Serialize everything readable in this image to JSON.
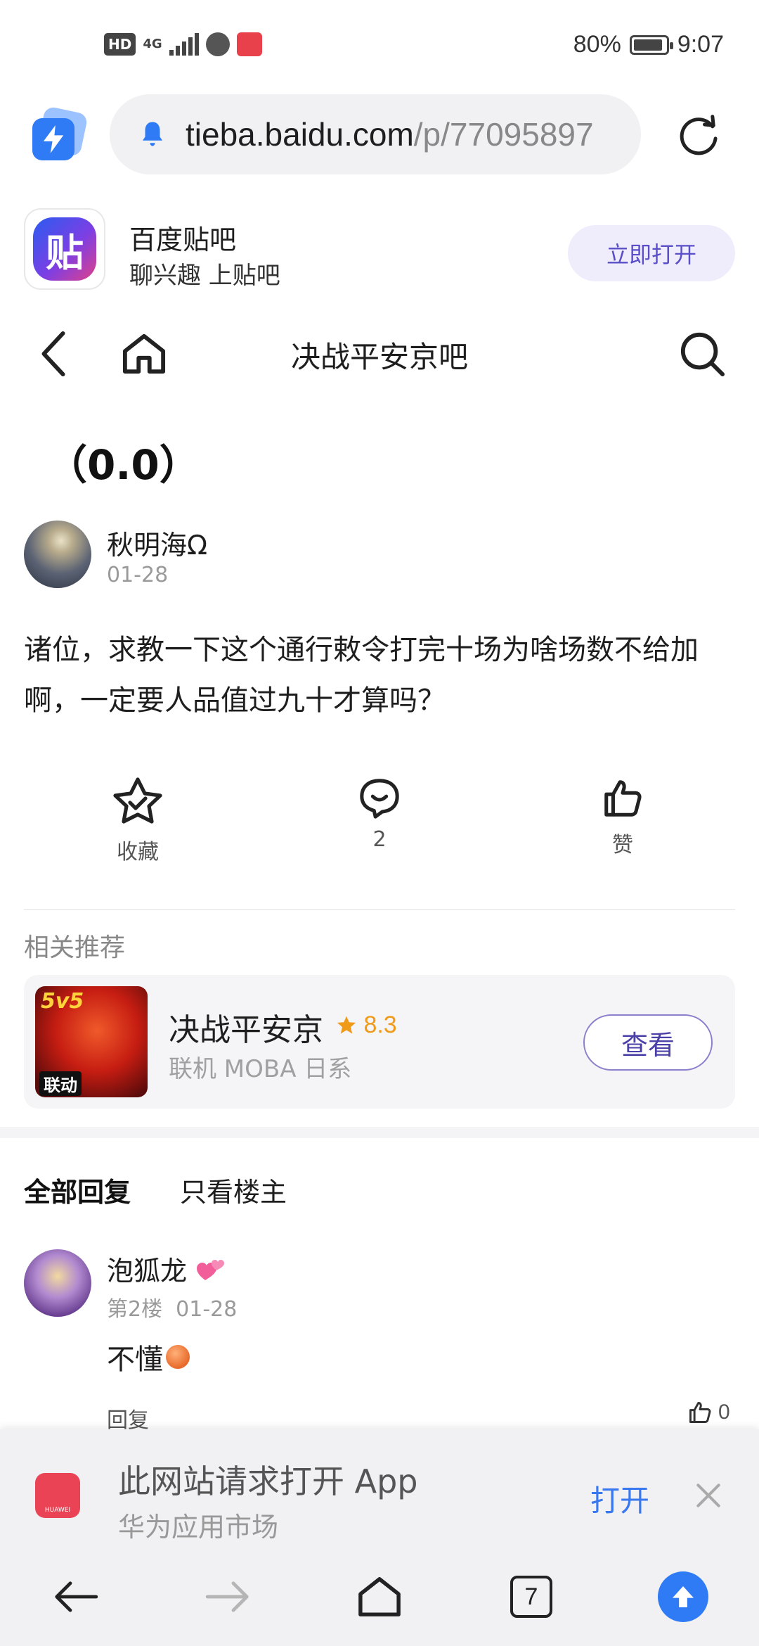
{
  "status_bar": {
    "hd": "HD",
    "network": "4G",
    "battery": "80%",
    "time": "9:07"
  },
  "address_bar": {
    "url_domain": "tieba.baidu.com",
    "url_path": "/p/77095897"
  },
  "app_banner": {
    "logo_char": "贴",
    "name": "百度贴吧",
    "slogan": "聊兴趣 上贴吧",
    "open_button": "立即打开"
  },
  "nav": {
    "title": "决战平安京吧"
  },
  "post": {
    "title": "（0.0）",
    "author": "秋明海Ω",
    "date": "01-28",
    "body": "诸位，求教一下这个通行敕令打完十场为啥场数不给加啊，一定要人品值过九十才算吗？",
    "actions": {
      "favorite_label": "收藏",
      "comment_count": "2",
      "like_label": "赞"
    }
  },
  "recommend": {
    "section_title": "相关推荐",
    "game": {
      "icon_top_text": "5v5",
      "icon_badge": "联动",
      "name": "决战平安京",
      "rating": "8.3",
      "tags": "联机 MOBA 日系",
      "view_button": "查看"
    }
  },
  "replies": {
    "tab_all": "全部回复",
    "tab_op": "只看楼主",
    "items": [
      {
        "name": "泡狐龙",
        "floor": "第2楼",
        "date": "01-28",
        "text": "不懂",
        "reply_label": "回复",
        "likes": "0"
      }
    ]
  },
  "app_prompt": {
    "title": "此网站请求打开 App",
    "source": "华为应用市场",
    "icon_text": "HUAWEI",
    "open_label": "打开"
  },
  "bottom_nav": {
    "tab_count": "7"
  },
  "colors": {
    "accent_blue": "#2f7bf5",
    "banner_button_bg": "#efecfb",
    "rating_orange": "#f09a1a"
  },
  "icons": [
    "bolt-icon",
    "bell-icon",
    "reload-icon",
    "back-icon",
    "home-icon",
    "search-icon",
    "star-icon",
    "comment-icon",
    "thumbs-up-icon",
    "heart-icon",
    "close-icon",
    "forward-icon",
    "tabs-icon",
    "upload-icon"
  ]
}
